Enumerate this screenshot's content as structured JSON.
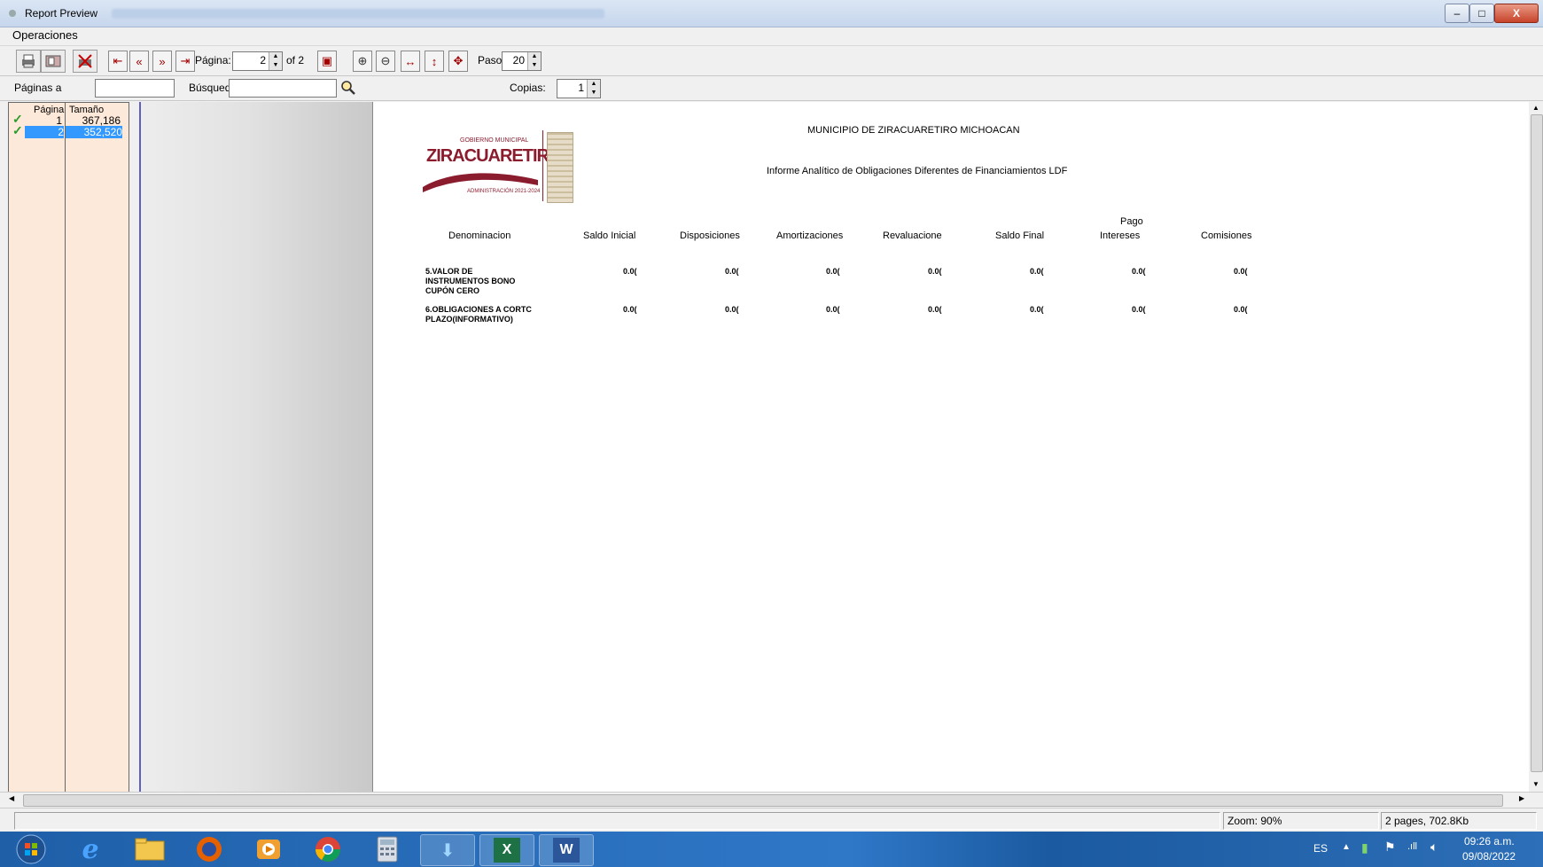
{
  "window": {
    "title": "Report Preview",
    "minimize_label": "–",
    "maximize_label": "□",
    "close_label": "X"
  },
  "menu": {
    "items": [
      "Operaciones"
    ]
  },
  "toolbar": {
    "page_label": "Página:",
    "page_value": "2",
    "of_label": "of 2",
    "step_label": "Paso:",
    "step_value": "20"
  },
  "searchbar": {
    "pages_label": "Páginas a",
    "search_label": "Búsqued",
    "copies_label": "Copias:",
    "copies_value": "1"
  },
  "page_list": {
    "headers": [
      "Página",
      "Tamaño"
    ],
    "rows": [
      {
        "page": "1",
        "size": "367,186"
      },
      {
        "page": "2",
        "size": "352,520"
      }
    ]
  },
  "report": {
    "municipality": "MUNICIPIO DE ZIRACUARETIRO MICHOACAN",
    "title": "Informe Analítico de Obligaciones Diferentes de Financiamientos LDF",
    "logo_top": "GOBIERNO MUNICIPAL",
    "logo_main": "ZIRACUARETIRO",
    "logo_bottom": "ADMINISTRACIÓN 2021-2024",
    "columns": [
      "Denominacion",
      "Saldo Inicial",
      "Disposiciones",
      "Amortizaciones",
      "Revaluacione",
      "Saldo Final",
      "Pago Intereses",
      "Comisiones"
    ],
    "col_pago_top": "Pago",
    "col_pago_bottom": "Intereses",
    "rows": [
      {
        "name_lines": [
          "5.VALOR DE",
          "INSTRUMENTOS BONO",
          "CUPÓN CERO"
        ],
        "values": [
          "0.0(",
          "0.0(",
          "0.0(",
          "0.0(",
          "0.0(",
          "0.0(",
          "0.0("
        ]
      },
      {
        "name_lines": [
          "6.OBLIGACIONES A CORTC",
          "PLAZO(INFORMATIVO)"
        ],
        "values": [
          "0.0(",
          "0.0(",
          "0.0(",
          "0.0(",
          "0.0(",
          "0.0(",
          "0.0("
        ]
      }
    ]
  },
  "status": {
    "zoom": "Zoom: 90%",
    "pages": "2 pages, 702.8Kb"
  },
  "taskbar": {
    "lang": "ES",
    "time": "09:26 a.m.",
    "date": "09/08/2022",
    "excel_letter": "X",
    "word_letter": "W"
  },
  "colors": {
    "logo_red": "#8b1c2e",
    "page_list_bg": "#fde9d9",
    "selection": "#3399ff",
    "taskbar": "#2a6fbf"
  }
}
